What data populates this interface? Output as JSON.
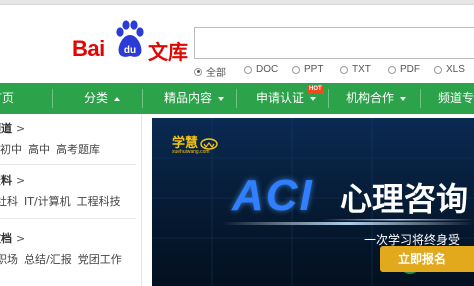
{
  "brand": {
    "bai": "Bai",
    "du": "du",
    "wenku": "文库"
  },
  "search": {
    "placeholder": ""
  },
  "filters": [
    {
      "label": "全部",
      "checked": true
    },
    {
      "label": "DOC",
      "checked": false
    },
    {
      "label": "PPT",
      "checked": false
    },
    {
      "label": "TXT",
      "checked": false
    },
    {
      "label": "PDF",
      "checked": false
    },
    {
      "label": "XLS",
      "checked": false
    }
  ],
  "nav": {
    "items": [
      {
        "label": "首页"
      },
      {
        "label": "分类"
      },
      {
        "label": "精品内容"
      },
      {
        "label": "申请认证"
      },
      {
        "label": "机构合作"
      },
      {
        "label": "频道专"
      }
    ],
    "hot_badge": "HOT"
  },
  "sidebar": {
    "categories": [
      {
        "title": "频道",
        "links": [
          "初中",
          "高中",
          "高考题库"
        ]
      },
      {
        "title": "资料",
        "links": [
          "社科",
          "IT/计算机",
          "工程科技"
        ]
      },
      {
        "title": "文档",
        "links": [
          "职场",
          "总结/汇报",
          "党团工作"
        ]
      }
    ]
  },
  "banner": {
    "logo_text": "学慧",
    "logo_sub": "xuehuiwang.com",
    "headline_en": "ACI",
    "headline_cn": "心理咨询",
    "subline": "一次学习将终身受",
    "cta": "立即报名"
  },
  "colors": {
    "brand_red": "#e10601",
    "brand_blue": "#2b3bd6",
    "nav_green": "#2ca24b",
    "hot": "#f24a1d",
    "banner_bg": "#061a33",
    "accent_gold": "#f2c318"
  }
}
